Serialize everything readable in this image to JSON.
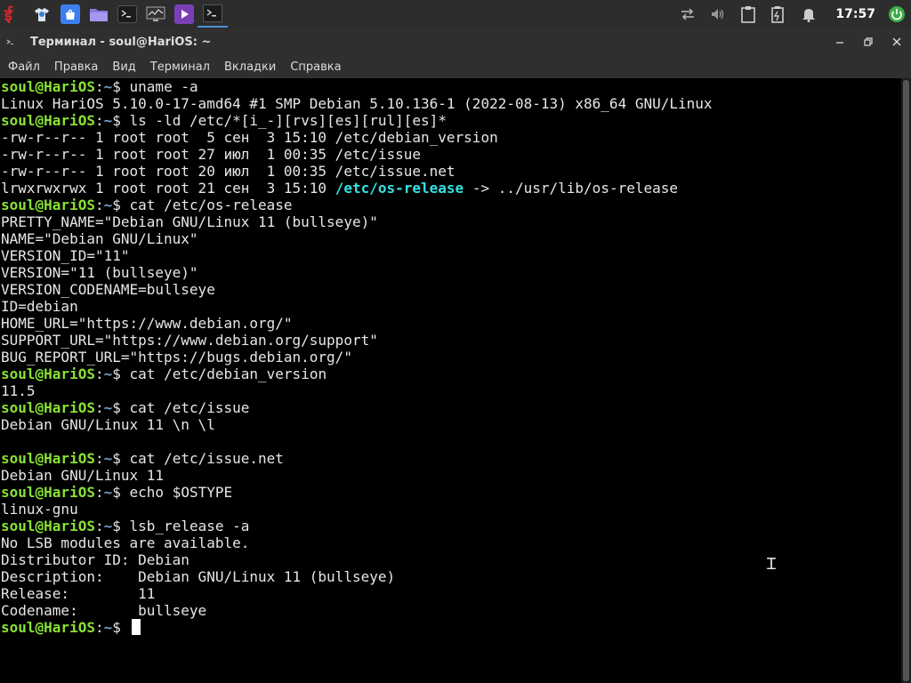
{
  "panel": {
    "clock": "17:57",
    "launchers": [
      "app-menu-icon",
      "browser-icon",
      "store-icon",
      "files-icon",
      "terminal-icon",
      "monitor-icon",
      "media-player-icon",
      "terminal-task-icon"
    ],
    "tray": [
      "network-icon",
      "volume-icon",
      "clipboard-icon",
      "battery-icon",
      "notifications-icon",
      "session-icon"
    ],
    "accent": "#4a90d9"
  },
  "window": {
    "title": "Терминал - soul@HariOS: ~",
    "menu": [
      "Файл",
      "Правка",
      "Вид",
      "Терминал",
      "Вкладки",
      "Справка"
    ]
  },
  "terminal": {
    "prompt_user": "soul@HariOS",
    "prompt_sep": ":",
    "prompt_path": "~",
    "prompt_sign": "$",
    "lines": [
      {
        "type": "prompt",
        "cmd": "uname -a"
      },
      {
        "type": "out",
        "text": "Linux HariOS 5.10.0-17-amd64 #1 SMP Debian 5.10.136-1 (2022-08-13) x86_64 GNU/Linux"
      },
      {
        "type": "prompt",
        "cmd": "ls -ld /etc/*[i_-][rvs][es][rul][es]*"
      },
      {
        "type": "out",
        "text": "-rw-r--r-- 1 root root  5 сен  3 15:10 /etc/debian_version"
      },
      {
        "type": "out",
        "text": "-rw-r--r-- 1 root root 27 июл  1 00:35 /etc/issue"
      },
      {
        "type": "out",
        "text": "-rw-r--r-- 1 root root 20 июл  1 00:35 /etc/issue.net"
      },
      {
        "type": "link",
        "pre": "lrwxrwxrwx 1 root root 21 сен  3 15:10 ",
        "name": "/etc/os-release",
        "post": " -> ../usr/lib/os-release"
      },
      {
        "type": "prompt",
        "cmd": "cat /etc/os-release"
      },
      {
        "type": "out",
        "text": "PRETTY_NAME=\"Debian GNU/Linux 11 (bullseye)\""
      },
      {
        "type": "out",
        "text": "NAME=\"Debian GNU/Linux\""
      },
      {
        "type": "out",
        "text": "VERSION_ID=\"11\""
      },
      {
        "type": "out",
        "text": "VERSION=\"11 (bullseye)\""
      },
      {
        "type": "out",
        "text": "VERSION_CODENAME=bullseye"
      },
      {
        "type": "out",
        "text": "ID=debian"
      },
      {
        "type": "out",
        "text": "HOME_URL=\"https://www.debian.org/\""
      },
      {
        "type": "out",
        "text": "SUPPORT_URL=\"https://www.debian.org/support\""
      },
      {
        "type": "out",
        "text": "BUG_REPORT_URL=\"https://bugs.debian.org/\""
      },
      {
        "type": "prompt",
        "cmd": "cat /etc/debian_version"
      },
      {
        "type": "out",
        "text": "11.5"
      },
      {
        "type": "prompt",
        "cmd": "cat /etc/issue"
      },
      {
        "type": "out",
        "text": "Debian GNU/Linux 11 \\n \\l"
      },
      {
        "type": "out",
        "text": ""
      },
      {
        "type": "prompt",
        "cmd": "cat /etc/issue.net"
      },
      {
        "type": "out",
        "text": "Debian GNU/Linux 11"
      },
      {
        "type": "prompt",
        "cmd": "echo $OSTYPE"
      },
      {
        "type": "out",
        "text": "linux-gnu"
      },
      {
        "type": "prompt",
        "cmd": "lsb_release -a"
      },
      {
        "type": "out",
        "text": "No LSB modules are available."
      },
      {
        "type": "out",
        "text": "Distributor ID:\tDebian"
      },
      {
        "type": "out",
        "text": "Description:\tDebian GNU/Linux 11 (bullseye)"
      },
      {
        "type": "out",
        "text": "Release:\t11"
      },
      {
        "type": "out",
        "text": "Codename:\tbullseye"
      },
      {
        "type": "prompt",
        "cmd": "",
        "cursor": true
      }
    ]
  }
}
